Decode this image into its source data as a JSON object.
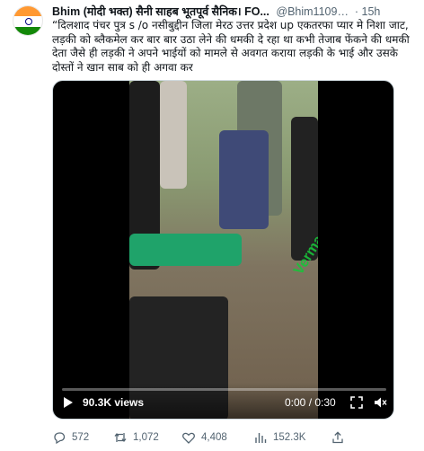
{
  "tweet": {
    "author_name": "Bhim (मोदी भक्त) सैनी साहब भूतपूर्व सैनिक। FO...",
    "handle": "@Bhim11090...",
    "separator": "·",
    "time": "15h",
    "text": "“दिलशाद पंचर पुत्र s /o नसीबुद्दीन जिला मेरठ उत्तर प्रदेश up एकतरफा प्यार मे निशा जाट, लड़की को ब्लैकमेल कर बार बार उठा लेने की धमकी दे रहा था कभी तेजाब फेंकने की धमकी देता जैसे ही लड़की ने अपने भाईयों को मामले से अवगत कराया लड़की के भाई और उसके दोस्तों ने खान साब को ही अगवा कर"
  },
  "video": {
    "watermark": "Verma shah",
    "views": "90.3K views",
    "time": "0:00 / 0:30",
    "progress": 0
  },
  "actions": {
    "replies": "572",
    "retweets": "1,072",
    "likes": "4,408",
    "views": "152.3K"
  },
  "colors": {
    "text": "#0f1419",
    "muted": "#536471",
    "border": "#cfd9de",
    "watermark": "#19c33a"
  },
  "icons": [
    "india-flag-avatar",
    "play-icon",
    "expand-icon",
    "mute-icon",
    "reply-icon",
    "retweet-icon",
    "like-icon",
    "views-icon",
    "share-icon"
  ]
}
